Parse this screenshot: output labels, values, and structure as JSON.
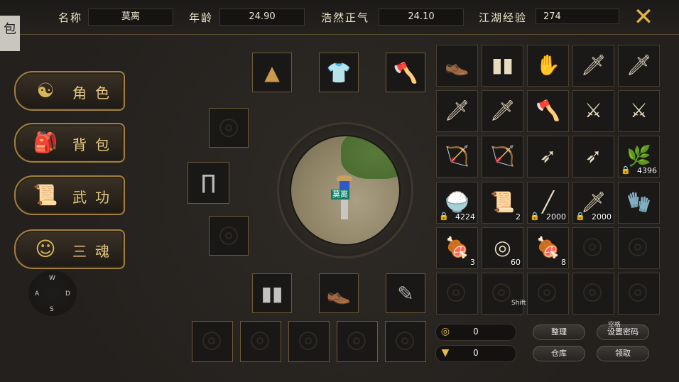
{
  "header": {
    "name_label": "名称",
    "name_value": "莫离",
    "age_label": "年龄",
    "age_value": "24.90",
    "qi_label": "浩然正气",
    "qi_value": "24.10",
    "exp_label": "江湖经验",
    "exp_value": "274"
  },
  "side_tab": "包",
  "menu": [
    {
      "label": "角色",
      "icon": "meditating-figure-icon"
    },
    {
      "label": "背包",
      "icon": "backpack-icon"
    },
    {
      "label": "武功",
      "icon": "scroll-icon"
    },
    {
      "label": "三魂",
      "icon": "mask-icon"
    }
  ],
  "joystick": {
    "n": "W",
    "w": "A",
    "e": "D",
    "s": "S"
  },
  "character": {
    "name": "莫离"
  },
  "equipment": [
    {
      "slot": "hat",
      "icon": "straw-hat-icon"
    },
    {
      "slot": "armor",
      "icon": "blue-robe-icon"
    },
    {
      "slot": "weapon",
      "icon": "axe-icon"
    },
    {
      "slot": "empty-left-1",
      "icon": ""
    },
    {
      "slot": "pants",
      "icon": "pants-icon"
    },
    {
      "slot": "empty-left-3",
      "icon": ""
    },
    {
      "slot": "bracers",
      "icon": "bracers-icon"
    },
    {
      "slot": "boots",
      "icon": "boots-icon"
    },
    {
      "slot": "feather",
      "icon": "feather-icon"
    },
    {
      "slot": "bottom-1",
      "icon": ""
    },
    {
      "slot": "bottom-2",
      "icon": ""
    },
    {
      "slot": "bottom-3",
      "icon": ""
    },
    {
      "slot": "bottom-4",
      "icon": ""
    },
    {
      "slot": "bottom-5",
      "icon": ""
    }
  ],
  "inventory": [
    {
      "icon": "boots-icon",
      "glyph": "👞",
      "count": "",
      "locked": false
    },
    {
      "icon": "bracers-icon",
      "glyph": "▮▮",
      "count": "",
      "locked": false
    },
    {
      "icon": "gloves-icon",
      "glyph": "✋",
      "count": "",
      "locked": false
    },
    {
      "icon": "sword-icon",
      "glyph": "🗡",
      "count": "",
      "locked": false
    },
    {
      "icon": "sword-icon",
      "glyph": "🗡",
      "count": "",
      "locked": false
    },
    {
      "icon": "sword-icon",
      "glyph": "🗡",
      "count": "",
      "locked": false
    },
    {
      "icon": "sword-icon",
      "glyph": "🗡",
      "count": "",
      "locked": false
    },
    {
      "icon": "axe-icon",
      "glyph": "🪓",
      "count": "",
      "locked": false
    },
    {
      "icon": "halberd-icon",
      "glyph": "⚔",
      "count": "",
      "locked": false
    },
    {
      "icon": "halberd-icon",
      "glyph": "⚔",
      "count": "",
      "locked": false
    },
    {
      "icon": "bow-icon",
      "glyph": "🏹",
      "count": "",
      "locked": false
    },
    {
      "icon": "bow-icon",
      "glyph": "🏹",
      "count": "",
      "locked": false
    },
    {
      "icon": "dart-icon",
      "glyph": "➶",
      "count": "",
      "locked": false
    },
    {
      "icon": "dart-icon",
      "glyph": "➶",
      "count": "",
      "locked": false
    },
    {
      "icon": "herb-icon",
      "glyph": "🌿",
      "count": "4396",
      "locked": true
    },
    {
      "icon": "rice-bag-icon",
      "glyph": "🍚",
      "count": "4224",
      "locked": true
    },
    {
      "icon": "scroll-icon",
      "glyph": "📜",
      "count": "2",
      "locked": false
    },
    {
      "icon": "spear-icon",
      "glyph": "╱",
      "count": "2000",
      "locked": true
    },
    {
      "icon": "sword-icon",
      "glyph": "🗡",
      "count": "2000",
      "locked": true
    },
    {
      "icon": "gauntlet-icon",
      "glyph": "🧤",
      "count": "",
      "locked": false
    },
    {
      "icon": "meat-icon",
      "glyph": "🍖",
      "count": "3",
      "locked": false
    },
    {
      "icon": "coin-icon",
      "glyph": "◎",
      "count": "60",
      "locked": false
    },
    {
      "icon": "meat-icon",
      "glyph": "🍖",
      "count": "8",
      "locked": false
    },
    {
      "icon": "",
      "glyph": "",
      "count": "",
      "locked": false
    },
    {
      "icon": "",
      "glyph": "",
      "count": "",
      "locked": false
    },
    {
      "icon": "",
      "glyph": "",
      "count": "",
      "locked": false
    },
    {
      "icon": "",
      "glyph": "",
      "count": "",
      "locked": false
    },
    {
      "icon": "",
      "glyph": "",
      "count": "",
      "locked": false
    },
    {
      "icon": "",
      "glyph": "",
      "count": "",
      "locked": false
    },
    {
      "icon": "",
      "glyph": "",
      "count": "",
      "locked": false
    }
  ],
  "currency": {
    "copper": "0",
    "gold": "0"
  },
  "buttons": {
    "sort": "整理",
    "set_password": "设置密码",
    "warehouse": "仓库",
    "claim": "领取"
  },
  "hints": {
    "shift": "Shift",
    "space": "空格"
  },
  "colors": {
    "accent": "#e0b34a",
    "name_tag": "#0f7c68"
  }
}
